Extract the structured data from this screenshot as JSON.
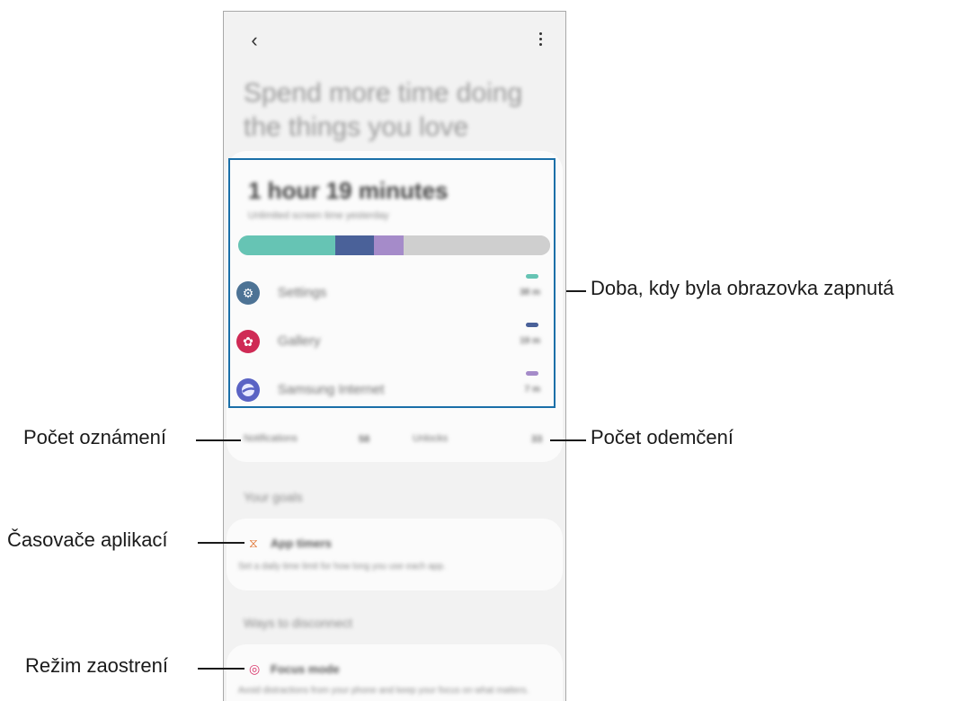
{
  "phone": {
    "headline": "Spend more time doing the things you love",
    "screen_time": {
      "total": "1 hour 19 minutes",
      "subtitle": "Unlimited screen time yesterday",
      "bar_colors": [
        "#66c4b4",
        "#4a6199",
        "#a58bc9",
        "#cfcfcf"
      ],
      "bar_fractions": [
        0.31,
        0.125,
        0.095,
        0.47
      ],
      "apps": [
        {
          "name": "Settings",
          "time": "38 m",
          "color": "#4d7395",
          "icon": "gear-icon",
          "dash": "#66c4b4"
        },
        {
          "name": "Gallery",
          "time": "19 m",
          "color": "#cf2a55",
          "icon": "flower-icon",
          "dash": "#4a6199"
        },
        {
          "name": "Samsung Internet",
          "time": "7 m",
          "color": "#5a63c4",
          "icon": "globe-icon",
          "dash": "#a58bc9"
        }
      ],
      "notifications_label": "Notifications",
      "notifications_count": "58",
      "unlocks_label": "Unlocks",
      "unlocks_count": "33"
    },
    "goals_title": "Your goals",
    "app_timers": {
      "title": "App timers",
      "desc": "Set a daily time limit for how long you use each app."
    },
    "disconnect_title": "Ways to disconnect",
    "focus_mode": {
      "title": "Focus mode",
      "desc": "Avoid distractions from your phone and keep your focus on what matters."
    }
  },
  "annotations": {
    "screen_time": "Doba, kdy byla obrazovka zapnutá",
    "notifications": "Počet oznámení",
    "unlocks": "Počet odemčení",
    "app_timers": "Časovače aplikací",
    "focus_mode": "Režim zaostrení"
  }
}
